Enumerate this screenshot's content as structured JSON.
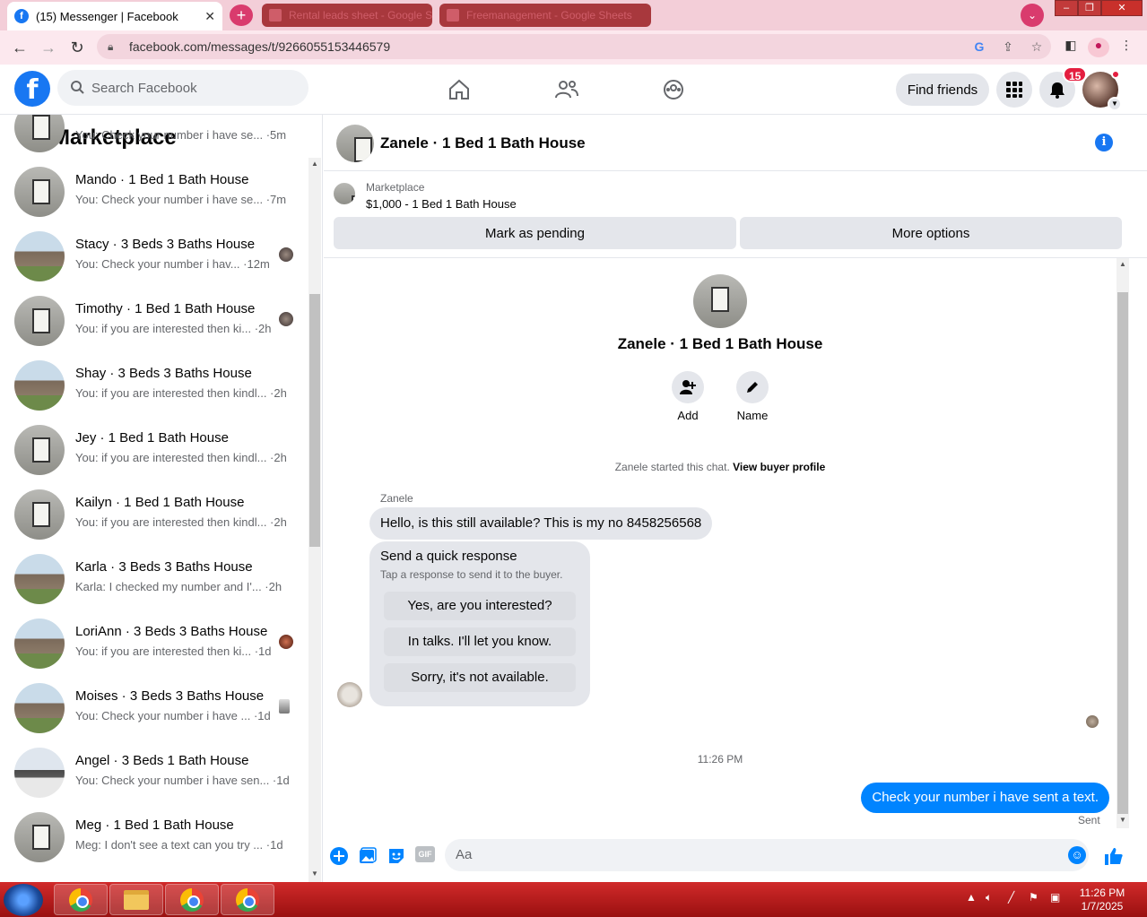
{
  "browser": {
    "tab_title": "(15) Messenger | Facebook",
    "other_tabs": [
      "Rental leads sheet - Google Sh...",
      "Freemanagement - Google Sheets"
    ],
    "url": "facebook.com/messages/t/9266055153446579",
    "new_tab": "+",
    "close": "✕"
  },
  "fb": {
    "logo": "f",
    "search_placeholder": "Search Facebook",
    "find_friends": "Find friends",
    "notification_count": "15"
  },
  "left": {
    "title": "Marketplace",
    "conversations": [
      {
        "name": "",
        "preview": "You: Check your number i have se... ·5m"
      },
      {
        "name": "Mando · 1 Bed 1 Bath House",
        "preview": "You: Check your number i have se... ·7m"
      },
      {
        "name": "Stacy · 3 Beds 3 Baths House",
        "preview": "You: Check your number i hav... ·12m"
      },
      {
        "name": "Timothy · 1 Bed 1 Bath House",
        "preview": "You: if you are interested then ki... ·2h"
      },
      {
        "name": "Shay · 3 Beds 3 Baths House",
        "preview": "You: if you are interested then kindl... ·2h"
      },
      {
        "name": "Jey · 1 Bed 1 Bath House",
        "preview": "You: if you are interested then kindl... ·2h"
      },
      {
        "name": "Kailyn · 1 Bed 1 Bath House",
        "preview": "You: if you are interested then kindl... ·2h"
      },
      {
        "name": "Karla · 3 Beds 3 Baths House",
        "preview": "Karla: I checked my number and I'... ·2h"
      },
      {
        "name": "LoriAnn · 3 Beds 3 Baths House",
        "preview": "You: if you are interested then ki... ·1d"
      },
      {
        "name": "Moises · 3 Beds 3 Baths House",
        "preview": "You: Check your number i have ... ·1d"
      },
      {
        "name": "Angel · 3 Beds 1 Bath House",
        "preview": "You: Check your number i have sen... ·1d"
      },
      {
        "name": "Meg · 1 Bed 1 Bath House",
        "preview": "Meg: I don't see a text can you try ... ·1d"
      }
    ]
  },
  "chat": {
    "title": "Zanele · 1 Bed 1 Bath House",
    "listing_label": "Marketplace",
    "listing_price": "$1,000 - 1 Bed 1 Bath House",
    "mark_pending": "Mark as pending",
    "more_options": "More options",
    "profile_name": "Zanele · 1 Bed 1 Bath House",
    "add_label": "Add",
    "name_label": "Name",
    "started_text": "Zanele started this chat.",
    "view_buyer": "View buyer profile",
    "sender": "Zanele",
    "incoming_message": "Hello, is this still available? This is my no 8458256568",
    "quick_title": "Send a quick response",
    "quick_subtitle": "Tap a response to send it to the buyer.",
    "quick_responses": [
      "Yes, are you interested?",
      "In talks. I'll let you know.",
      "Sorry, it's not available."
    ],
    "timestamp": "11:26 PM",
    "outgoing_message": "Check your number i have sent a text.",
    "status": "Sent",
    "composer_placeholder": "Aa",
    "gif": "GIF"
  },
  "taskbar": {
    "time": "11:26 PM",
    "date": "1/7/2025"
  }
}
